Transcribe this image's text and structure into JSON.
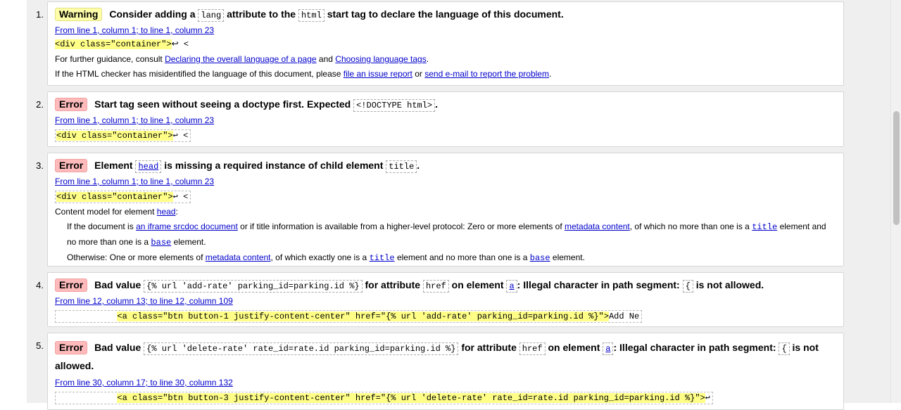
{
  "messages": [
    {
      "num": "1.",
      "type": "Warning",
      "head_pre": "Consider adding a",
      "code1": "lang",
      "head_mid": "attribute to the",
      "code2": "html",
      "head_post": "start tag to declare the language of this document.",
      "location": "From line 1, column 1; to line 1, column 23",
      "extract": "<div class=\"container\">",
      "extract_tail": "↩    <",
      "guidance_pre": "For further guidance, consult",
      "guidance_link1": "Declaring the overall language of a page",
      "guidance_and": "and",
      "guidance_link2": "Choosing language tags",
      "guidance_end": ".",
      "misid_pre": "If the HTML checker has misidentified the language of this document, please",
      "misid_link1": "file an issue report",
      "misid_or": "or",
      "misid_link2": "send e-mail to report the problem",
      "misid_end": "."
    },
    {
      "num": "2.",
      "type": "Error",
      "head_pre": "Start tag seen without seeing a doctype first. Expected",
      "code1": "<!DOCTYPE html>",
      "head_post": ".",
      "location": "From line 1, column 1; to line 1, column 23",
      "extract": "<div class=\"container\">",
      "extract_tail": "↩    <"
    },
    {
      "num": "3.",
      "type": "Error",
      "head_pre": "Element",
      "code_link": "head",
      "head_mid": "is missing a required instance of child element",
      "code1": "title",
      "head_post": ".",
      "location": "From line 1, column 1; to line 1, column 23",
      "extract": "<div class=\"container\">",
      "extract_tail": "↩    <",
      "cm_pre": "Content model for element",
      "cm_link": "head",
      "cm_end": ":",
      "p1_pre": "If the document is",
      "p1_link1": "an iframe srcdoc document",
      "p1_mid": "or if title information is available from a higher-level protocol: Zero or more elements of",
      "p1_link2": "metadata content",
      "p1_mid2": ", of which no more than one is a",
      "p1_link3": "title",
      "p1_mid3": "element and no more than one is a",
      "p1_link4": "base",
      "p1_end": "element.",
      "p2_pre": "Otherwise: One or more elements of",
      "p2_link1": "metadata content",
      "p2_mid": ", of which exactly one is a",
      "p2_link2": "title",
      "p2_mid2": "element and no more than one is a",
      "p2_link3": "base",
      "p2_end": "element."
    },
    {
      "num": "4.",
      "type": "Error",
      "head_pre": "Bad value",
      "code1": "{% url 'add-rate' parking_id=parking.id %}",
      "head_mid": "for attribute",
      "code2": "href",
      "head_mid2": "on element",
      "code_link": "a",
      "head_mid3": ": Illegal character in path segment:",
      "code3": "{",
      "head_post": "is not allowed.",
      "location": "From line 12, column 13; to line 12, column 109",
      "extract_lead": "            ",
      "extract": "<a class=\"btn button-1 justify-content-center\" href=\"{% url 'add-rate' parking_id=parking.id %}\">",
      "extract_tail": "Add Ne"
    },
    {
      "num": "5.",
      "type": "Error",
      "head_pre": "Bad value",
      "code1": "{% url 'delete-rate' rate_id=rate.id parking_id=parking.id %}",
      "head_mid": "for attribute",
      "code2": "href",
      "head_mid2": "on element",
      "code_link": "a",
      "head_mid3": ": Illegal character in path segment:",
      "code3": "{",
      "head_post": "is not allowed.",
      "location": "From line 30, column 17; to line 30, column 132",
      "extract_lead": "            ",
      "extract": "<a class=\"btn button-3 justify-content-center\" href=\"{% url 'delete-rate' rate_id=rate.id parking_id=parking.id %}\">",
      "extract_tail": "↩"
    }
  ]
}
